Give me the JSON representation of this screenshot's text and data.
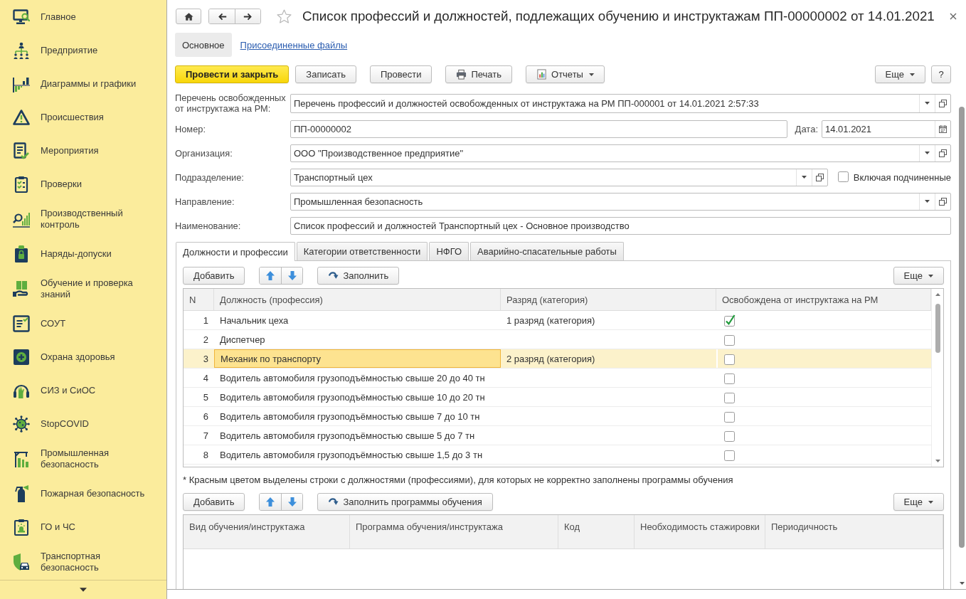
{
  "sidebar": {
    "items": [
      {
        "label": "Главное"
      },
      {
        "label": "Предприятие"
      },
      {
        "label": "Диаграммы и графики"
      },
      {
        "label": "Происшествия"
      },
      {
        "label": "Мероприятия"
      },
      {
        "label": "Проверки"
      },
      {
        "label": "Производственный контроль"
      },
      {
        "label": "Наряды-допуски"
      },
      {
        "label": "Обучение и проверка знаний"
      },
      {
        "label": "СОУТ"
      },
      {
        "label": "Охрана здоровья"
      },
      {
        "label": "СИЗ и СиОС"
      },
      {
        "label": "StopCOVID"
      },
      {
        "label": "Промышленная безопасность"
      },
      {
        "label": "Пожарная безопасность"
      },
      {
        "label": "ГО и ЧС"
      },
      {
        "label": "Транспортная безопасность"
      }
    ]
  },
  "window": {
    "title": "Список профессий и должностей, подлежащих обучению и инструктажам ПП-00000002 от 14.01.2021"
  },
  "form_tabs": [
    {
      "label": "Основное",
      "selected": true
    },
    {
      "label": "Присоединенные файлы",
      "selected": false
    }
  ],
  "toolbar": {
    "buttons": [
      {
        "label": "Провести и закрыть",
        "kind": "primary"
      },
      {
        "label": "Записать",
        "kind": "plain"
      },
      {
        "label": "Провести",
        "kind": "plain"
      },
      {
        "label": "Печать",
        "kind": "print"
      },
      {
        "label": "Отчеты",
        "kind": "reports"
      }
    ],
    "more": "Еще",
    "help": "?"
  },
  "fields": [
    {
      "kind": "select",
      "label": "Перечень освобожденных от инструктажа на РМ:",
      "value": "Перечень профессий и должностей освобожденных от инструктажа на РМ ПП-000001 от 14.01.2021 2:57:33"
    },
    {
      "kind": "number_date",
      "label": "Номер:",
      "value": "ПП-00000002",
      "date_label": "Дата:",
      "date_value": "14.01.2021"
    },
    {
      "kind": "select",
      "label": "Организация:",
      "value": "ООО \"Производственное предприятие\""
    },
    {
      "kind": "select_checkbox",
      "label": "Подразделение:",
      "value": "Транспортный цех",
      "checkbox": {
        "label": "Включая подчиненные",
        "checked": false
      }
    },
    {
      "kind": "select",
      "label": "Направление:",
      "value": "Промышленная безопасность"
    },
    {
      "kind": "text",
      "label": "Наименование:",
      "value": "Список профессий и должностей Транспортный цех - Основное производство"
    }
  ],
  "doc_tabs": [
    {
      "label": "Должности и профессии",
      "selected": true
    },
    {
      "label": "Категории ответственности",
      "selected": false
    },
    {
      "label": "НФГО",
      "selected": false
    },
    {
      "label": "Аварийно-спасательные работы",
      "selected": false
    }
  ],
  "positions": {
    "toolbar": {
      "add": "Добавить",
      "fill": "Заполнить",
      "more": "Еще"
    },
    "table": {
      "columns": [
        "N",
        "Должность (профессия)",
        "Разряд (категория)",
        "Освобождена от инструктажа на РМ"
      ],
      "rows": [
        {
          "n": "1",
          "position": "Начальник цеха",
          "grade": "1 разряд (категория)",
          "exempt": true,
          "selected": false
        },
        {
          "n": "2",
          "position": "Диспетчер",
          "exempt": false,
          "selected": false
        },
        {
          "n": "3",
          "position": "Механик по транспорту",
          "grade": "2 разряд (категория)",
          "exempt": false,
          "selected": true
        },
        {
          "n": "4",
          "position": "Водитель автомобиля грузоподъёмностью свыше 20 до 40 тн",
          "exempt": false,
          "selected": false
        },
        {
          "n": "5",
          "position": "Водитель автомобиля грузоподъёмностью свыше 10 до 20 тн",
          "exempt": false,
          "selected": false
        },
        {
          "n": "6",
          "position": "Водитель автомобиля грузоподъёмностью свыше 7 до 10 тн",
          "exempt": false,
          "selected": false
        },
        {
          "n": "7",
          "position": "Водитель автомобиля грузоподъёмностью свыше 5 до 7 тн",
          "exempt": false,
          "selected": false
        },
        {
          "n": "8",
          "position": "Водитель автомобиля грузоподъёмностью свыше 1,5 до 3 тн",
          "exempt": false,
          "selected": false
        }
      ]
    }
  },
  "note": "* Красным цветом выделены строки с должностями (профессиями), для которых не корректно заполнены программы обучения",
  "training": {
    "toolbar": {
      "add": "Добавить",
      "fill": "Заполнить программы обучения",
      "more": "Еще"
    },
    "table": {
      "columns": [
        "Вид обучения/инструктажа",
        "Программа обучения/инструктажа",
        "Код",
        "Необходимость стажировки",
        "Периодичность"
      ]
    }
  }
}
